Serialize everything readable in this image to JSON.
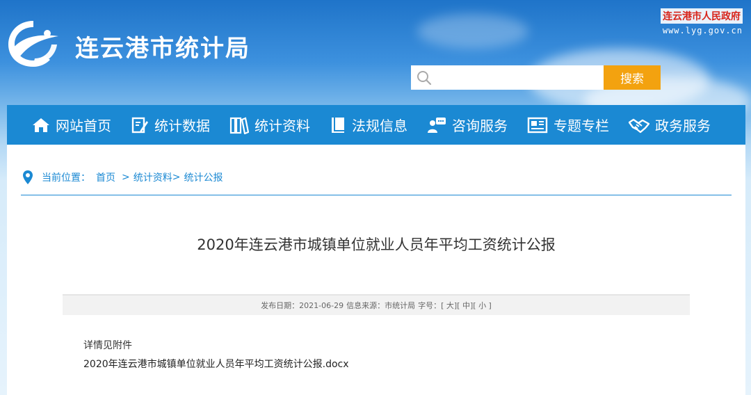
{
  "header": {
    "site_title": "连云港市统计局",
    "gov_link": {
      "name": "连云港市人民政府",
      "url": "www.lyg.gov.cn"
    },
    "logo_icon": "lyg-stats-logo-icon"
  },
  "search": {
    "placeholder": "",
    "value": "",
    "button_label": "搜索",
    "icon": "search-icon"
  },
  "nav": {
    "items": [
      {
        "label": "网站首页",
        "icon": "home-icon"
      },
      {
        "label": "统计数据",
        "icon": "edit-document-icon"
      },
      {
        "label": "统计资料",
        "icon": "books-icon"
      },
      {
        "label": "法规信息",
        "icon": "book-icon"
      },
      {
        "label": "咨询服务",
        "icon": "chat-user-icon"
      },
      {
        "label": "专题专栏",
        "icon": "newspaper-icon"
      },
      {
        "label": "政务服务",
        "icon": "handshake-icon"
      }
    ]
  },
  "breadcrumb": {
    "prefix": "当前位置：",
    "items": [
      "首页",
      "统计资料",
      "统计公报"
    ],
    "sep1": ">",
    "sep2": ">"
  },
  "article": {
    "title": "2020年连云港市城镇单位就业人员年平均工资统计公报",
    "meta": {
      "date_label": "发布日期：",
      "date": "2021-06-29",
      "source_label": "信息来源：",
      "source": "市统计局",
      "font_label": "字号：",
      "size_large": "大",
      "size_medium": "中",
      "size_small": "小"
    },
    "body": "详情见附件",
    "attachment": "2020年连云港市城镇单位就业人员年平均工资统计公报.docx"
  },
  "colors": {
    "nav_bg": "#1b89d3",
    "search_button": "#f3a20f",
    "gov_red": "#d8241a"
  }
}
